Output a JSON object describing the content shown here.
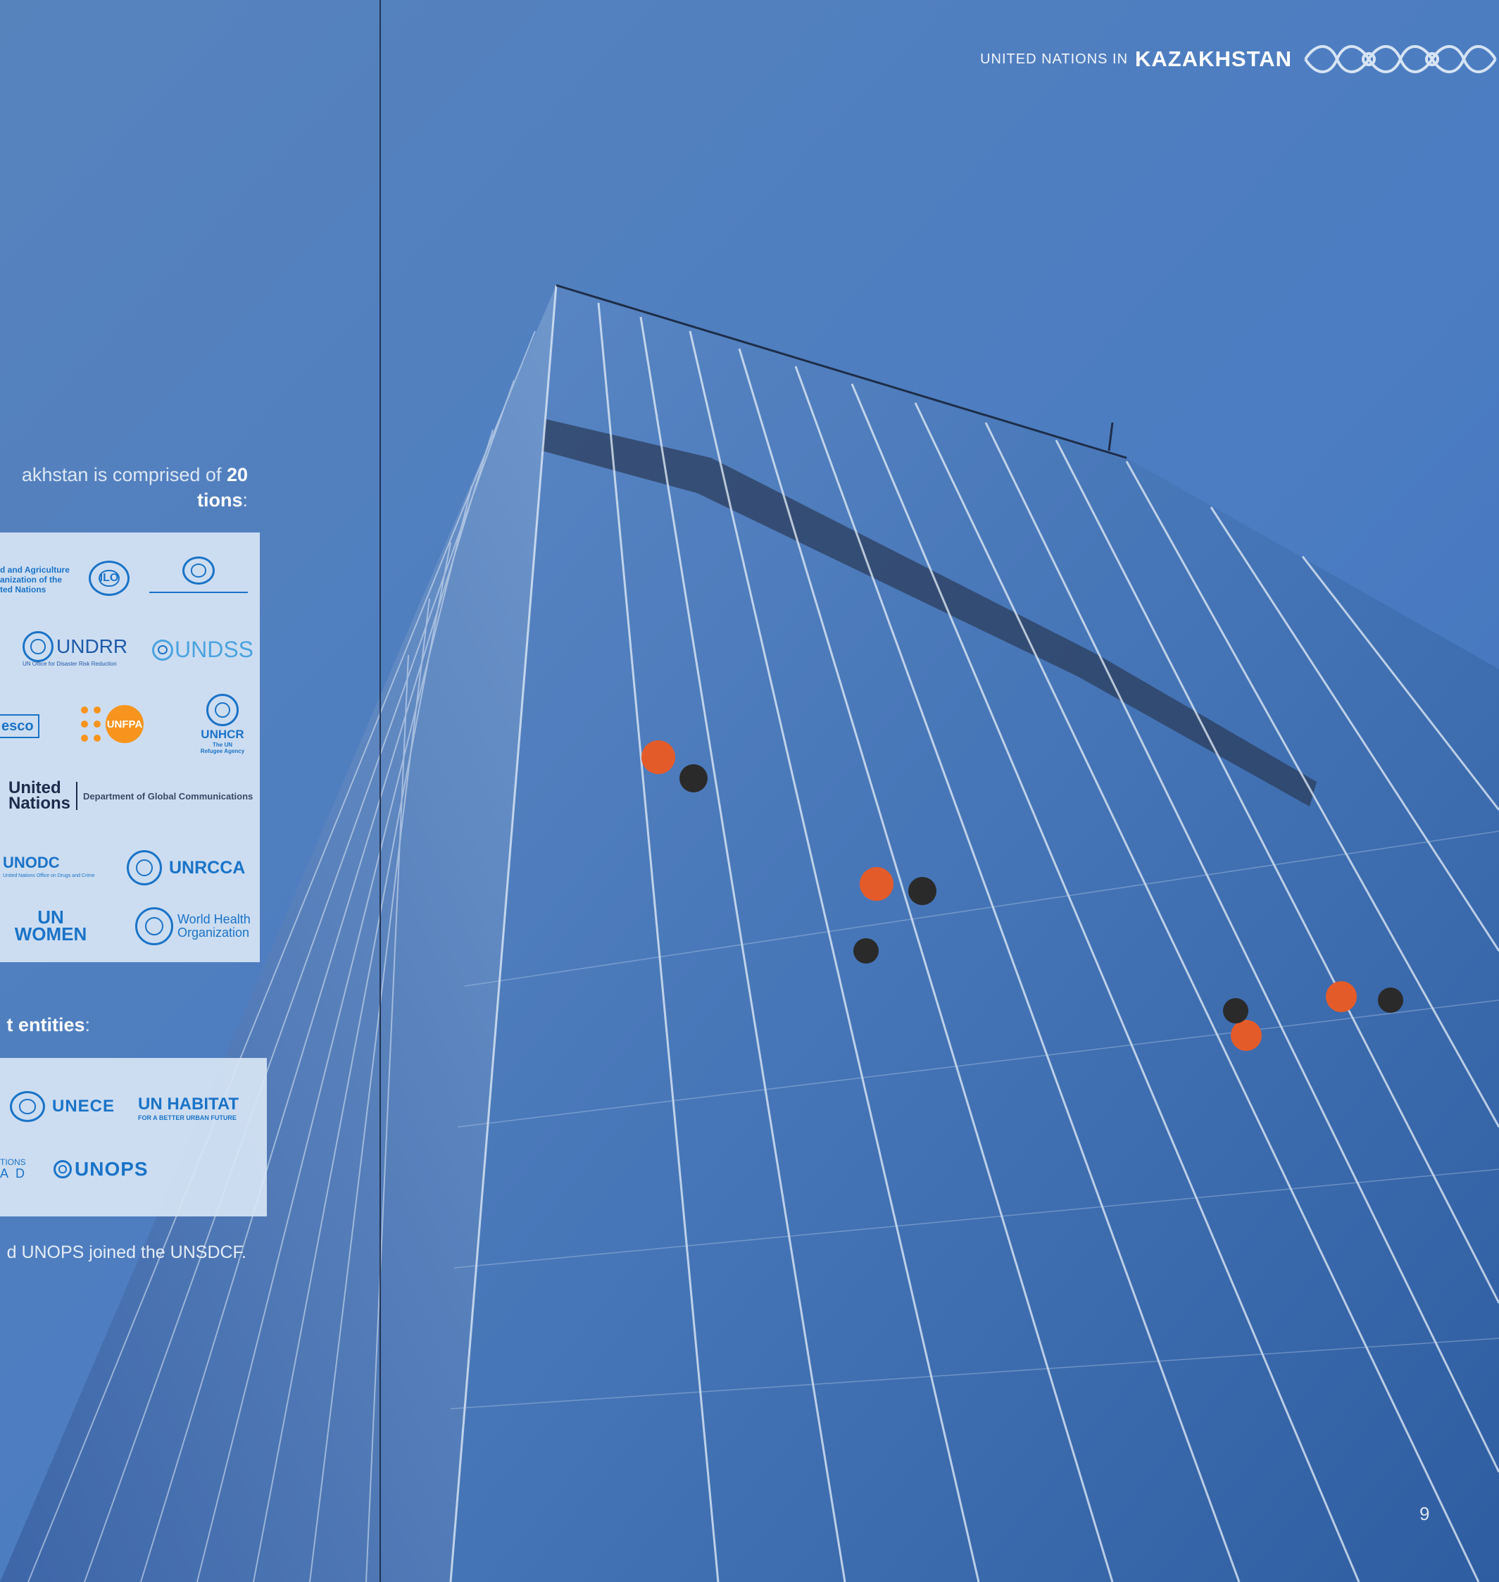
{
  "header": {
    "prefix": "UNITED NATIONS IN",
    "country": "KAZAKHSTAN"
  },
  "intro": {
    "part1": "akhstan is comprised of ",
    "bold_number": "20",
    "bold_tail": "tions",
    "colon": ":"
  },
  "logos": {
    "fao_line1": "d and Agriculture",
    "fao_line2": "anization of the",
    "fao_line3": "ted Nations",
    "ilo": "ILO",
    "undrr": "UNDRR",
    "undrr_sub": "UN Office for Disaster Risk Reduction",
    "undss": "UNDSS",
    "unesco": "esco",
    "unfpa": "UNFPA",
    "unhcr": "UNHCR",
    "unhcr_sub1": "The UN",
    "unhcr_sub2": "Refugee Agency",
    "un_line1": "United",
    "un_line2": "Nations",
    "dgc": "Department of Global Communications",
    "unodc": "UNODC",
    "unodc_sub": "United Nations Office on Drugs and Crime",
    "unrcca": "UNRCCA",
    "unwomen_line1": "UN",
    "unwomen_line2": "WOMEN",
    "who_line1": "World Health",
    "who_line2": "Organization",
    "unece": "UNECE",
    "unhabitat": "UN HABITAT",
    "unhabitat_sub": "FOR A BETTER URBAN FUTURE",
    "unctad_line1": "TIONS",
    "unctad_line2": "A D",
    "unops": "UNOPS"
  },
  "section2": {
    "bold": "t entities",
    "colon": ":"
  },
  "footnote": "d UNOPS joined the UNSDCF.",
  "page_number": "9",
  "colors": {
    "sky": "#4d7ec0",
    "panel": "#d6e4f4",
    "un_blue": "#1a73c7",
    "orange": "#f7941d"
  }
}
